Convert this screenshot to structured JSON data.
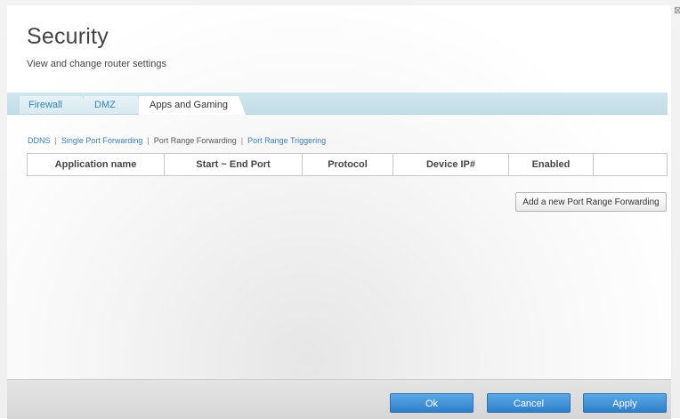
{
  "page": {
    "title": "Security",
    "subtitle": "View and change router settings"
  },
  "tabs": [
    {
      "label": "Firewall",
      "active": false
    },
    {
      "label": "DMZ",
      "active": false
    },
    {
      "label": "Apps and Gaming",
      "active": true
    }
  ],
  "subnav": [
    {
      "label": "DDNS",
      "current": false
    },
    {
      "label": "Single Port Forwarding",
      "current": false
    },
    {
      "label": "Port Range Forwarding",
      "current": true
    },
    {
      "label": "Port Range Triggering",
      "current": false
    }
  ],
  "table": {
    "columns": [
      "Application name",
      "Start ~ End Port",
      "Protocol",
      "Device IP#",
      "Enabled",
      ""
    ],
    "rows": []
  },
  "actions": {
    "add_label": "Add a new Port Range Forwarding"
  },
  "footer": {
    "ok_label": "Ok",
    "cancel_label": "Cancel",
    "apply_label": "Apply"
  },
  "colors": {
    "accent": "#3a7fb3",
    "button_blue": "#2f7fc9",
    "tabbar": "#c3dde6"
  },
  "icons": {
    "corner": "close-icon"
  }
}
